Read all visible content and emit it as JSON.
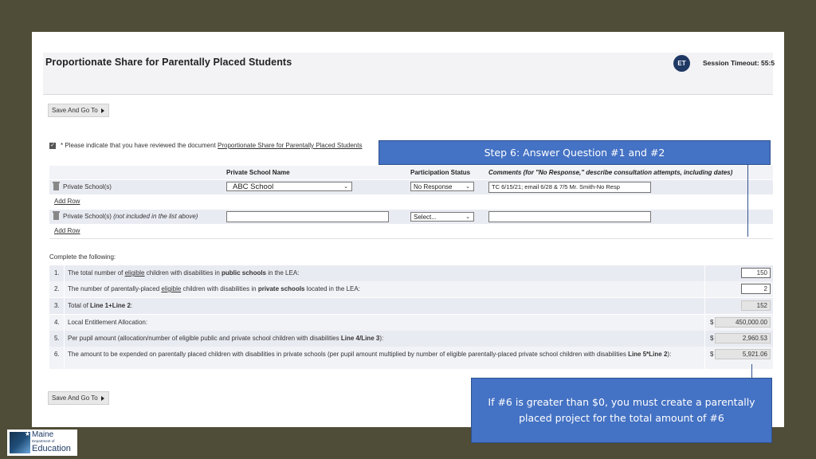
{
  "header": {
    "title": "Proportionate Share for Parentally Placed Students",
    "avatar_initials": "ET",
    "session_timeout": "Session Timeout: 55:5"
  },
  "toolbar": {
    "save_label_top": "Save And Go To",
    "save_label_bottom": "Save And Go To"
  },
  "acknowledgement": {
    "checked": true,
    "text": "* Please indicate that you have reviewed the document ",
    "link_text": "Proportionate Share for Parentally Placed Students"
  },
  "schools_table": {
    "columns": {
      "name": "Private School Name",
      "status": "Participation Status",
      "comments": "Comments (for \"No Response,\" describe consultation attempts, including dates)"
    },
    "rows": [
      {
        "label": "Private School(s)",
        "label_italic": "",
        "school_name": "ABC School",
        "status": "No Response",
        "comment": "TC 6/15/21; email 6/28 & 7/5 Mr. Smith-No Resp"
      },
      {
        "label": "Private School(s) ",
        "label_italic": "(not included in the list above)",
        "school_name": "",
        "status": "Select...",
        "comment": ""
      }
    ],
    "add_row_label": "Add Row"
  },
  "questions": {
    "intro": "Complete the following:",
    "items": [
      {
        "num": "1.",
        "pre": "The total number of ",
        "u": "eligible",
        "mid": " children with disabilities in ",
        "b": "public schools",
        "post": " in the LEA:",
        "value": "150",
        "dollar": "",
        "editable": true
      },
      {
        "num": "2.",
        "pre": "The number of parentally-placed ",
        "u": "eligible",
        "mid": " children with disabilities in ",
        "b": "private schools",
        "post": " located in the LEA:",
        "value": "2",
        "dollar": "",
        "editable": true
      },
      {
        "num": "3.",
        "pre": "Total of ",
        "u": "",
        "mid": "",
        "b": "Line 1+Line 2",
        "post": ":",
        "value": "152",
        "dollar": "",
        "editable": false
      },
      {
        "num": "4.",
        "pre": "Local Entitlement Allocation:",
        "u": "",
        "mid": "",
        "b": "",
        "post": "",
        "value": "450,000.00",
        "dollar": "$",
        "editable": false
      },
      {
        "num": "5.",
        "pre": "Per pupil amount (allocation/number of eligible public and private school children with disabilities ",
        "u": "",
        "mid": "",
        "b": "Line 4/Line 3",
        "post": "):",
        "value": "2,960.53",
        "dollar": "$",
        "editable": false
      },
      {
        "num": "6.",
        "pre": "The amount to be expended on parentally placed children with disabilities in private schools (per pupil amount multiplied by number of eligible parentally-placed private school children with disabilities ",
        "u": "",
        "mid": "",
        "b": "Line 5*Line 2",
        "post": "):",
        "value": "5,921.06",
        "dollar": "$",
        "editable": false
      }
    ]
  },
  "callouts": {
    "step6": "Step 6: Answer Question #1 and #2",
    "note": "If #6 is greater than $0, you must create a parentally placed project for the total amount of #6"
  },
  "logo": {
    "line1": "Maine",
    "line2": "Department of",
    "line3": "Education"
  }
}
